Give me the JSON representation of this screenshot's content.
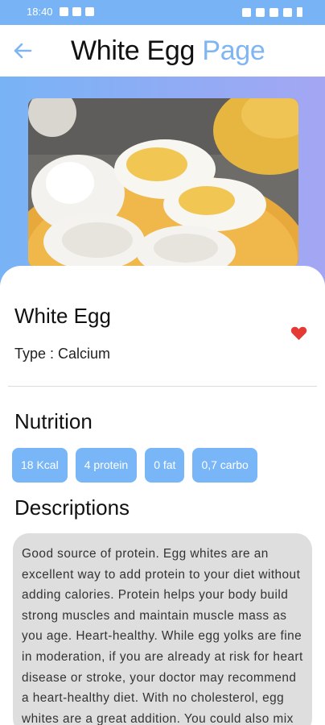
{
  "status_bar": {
    "time": "18:40"
  },
  "header": {
    "title_part1": "White Egg",
    "title_part2": "Page",
    "back_icon": "arrow-left-icon"
  },
  "hero": {
    "image_alt": "White egg halves on a plate"
  },
  "food": {
    "name": "White Egg",
    "type": "Type : Calcium",
    "favorite": true
  },
  "nutrition": {
    "heading": "Nutrition",
    "chips": [
      {
        "label": "18 Kcal"
      },
      {
        "label": "4 protein"
      },
      {
        "label": "0 fat"
      },
      {
        "label": "0,7 carbo"
      }
    ]
  },
  "descriptions": {
    "heading": "Descriptions",
    "text": "Good source of protein. Egg whites are an excellent way to add protein to your diet without adding calories. Protein helps your body build strong muscles and maintain muscle mass as you age.  Heart-healthy. While egg yolks are fine in moderation, if you are already at risk for heart disease or stroke, your doctor may recommend a heart-healthy diet. With no cholesterol, egg whites are a great addition. You could also mix"
  },
  "colors": {
    "accent": "#78b6f7",
    "title_accent": "#7fb6f2",
    "favorite": "#e53935",
    "desc_bg": "#dedede"
  }
}
